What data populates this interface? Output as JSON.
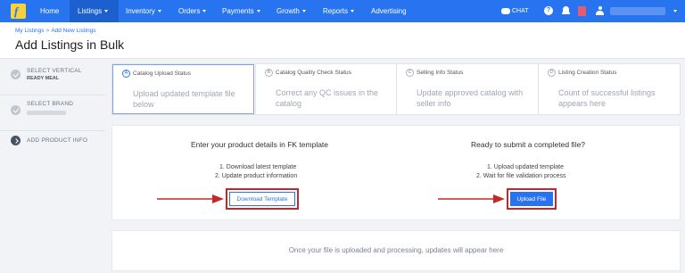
{
  "topnav": {
    "logo_icon": "flipkart-logo-icon",
    "items": [
      {
        "label": "Home",
        "has_dropdown": false
      },
      {
        "label": "Listings",
        "has_dropdown": true,
        "active": true
      },
      {
        "label": "Inventory",
        "has_dropdown": true
      },
      {
        "label": "Orders",
        "has_dropdown": true
      },
      {
        "label": "Payments",
        "has_dropdown": true
      },
      {
        "label": "Growth",
        "has_dropdown": true
      },
      {
        "label": "Reports",
        "has_dropdown": true
      },
      {
        "label": "Advertising",
        "has_dropdown": false
      }
    ],
    "chat_label": "CHAT",
    "help_icon": "?",
    "icons": [
      "chat-icon",
      "help-icon",
      "bell-icon",
      "bag-icon",
      "user-icon"
    ]
  },
  "header": {
    "breadcrumb": [
      "My Listings",
      "Add New Listings"
    ],
    "title": "Add Listings in Bulk"
  },
  "sidebar": {
    "steps": [
      {
        "label": "SELECT VERTICAL",
        "sub": "READY MEAL",
        "state": "done"
      },
      {
        "label": "SELECT BRAND",
        "sub": "",
        "state": "done"
      },
      {
        "label": "ADD PRODUCT INFO",
        "sub": "",
        "state": "current"
      }
    ]
  },
  "status_tabs": [
    {
      "letter": "A",
      "title": "Catalog Upload Status",
      "desc": "Upload updated template file below",
      "active": true
    },
    {
      "letter": "B",
      "title": "Catalog Quality Check Status",
      "desc": "Correct any QC issues in the catalog",
      "active": false
    },
    {
      "letter": "C",
      "title": "Selling Info Status",
      "desc": "Update approved catalog with seller info",
      "active": false
    },
    {
      "letter": "D",
      "title": "Listing Creation Status",
      "desc": "Count of successful listings appears here",
      "active": false
    }
  ],
  "download": {
    "title": "Enter your product details in FK template",
    "step1": "1. Download latest template",
    "step2": "2. Update product information",
    "button": "Download Template"
  },
  "upload": {
    "title": "Ready to submit a completed file?",
    "step1": "1. Upload updated template",
    "step2": "2. Wait for file validation process",
    "button": "Upload File"
  },
  "notice": "Once your file is uploaded and processing, updates will appear here",
  "colors": {
    "brand_blue": "#2874f0",
    "highlight_red": "#c62828",
    "logo_yellow": "#f7d23a"
  }
}
